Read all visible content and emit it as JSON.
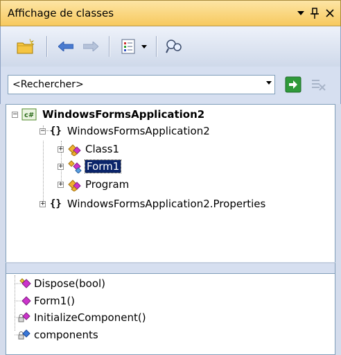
{
  "window": {
    "title": "Affichage de classes",
    "pin_glyph": "ɨ",
    "close_glyph": "×"
  },
  "toolbar": {
    "icons": [
      "new-folder-icon",
      "back-arrow-icon",
      "forward-arrow-icon",
      "view-settings-icon",
      "dropdown-icon",
      "find-symbol-icon"
    ]
  },
  "search": {
    "value": "<Rechercher>"
  },
  "tree": {
    "root": "WindowsFormsApplication2",
    "namespace": "WindowsFormsApplication2",
    "classes": [
      "Class1",
      "Form1",
      "Program"
    ],
    "namespace2": "WindowsFormsApplication2.Properties",
    "selected": "Form1"
  },
  "members": {
    "items": [
      "Dispose(bool)",
      "Form1()",
      "InitializeComponent()",
      "components"
    ]
  },
  "colors": {
    "title_bar": "#f7c95e",
    "selection": "#0a246a",
    "accent_purple": "#cc33cc"
  }
}
